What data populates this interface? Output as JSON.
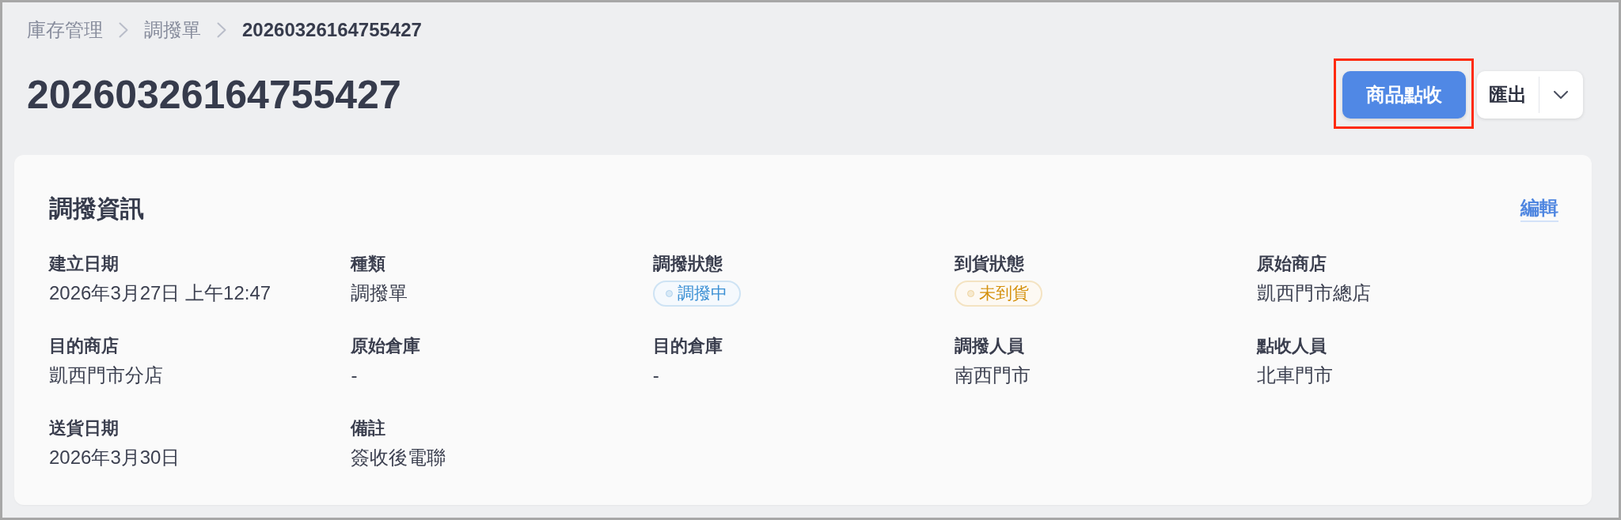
{
  "breadcrumb": [
    {
      "label": "庫存管理",
      "current": false
    },
    {
      "label": "調撥單",
      "current": false
    },
    {
      "label": "20260326164755427",
      "current": true
    }
  ],
  "page_title": "20260326164755427",
  "actions": {
    "primary": {
      "label": "商品點收",
      "highlighted": true
    },
    "export": {
      "label": "匯出"
    }
  },
  "card": {
    "title": "調撥資訊",
    "edit_link": "編輯",
    "fields": [
      {
        "label": "建立日期",
        "kind": "text",
        "value": "2026年3月27日 上午12:47"
      },
      {
        "label": "種類",
        "kind": "text",
        "value": "調撥單"
      },
      {
        "label": "調撥狀態",
        "kind": "badge",
        "value": "調撥中",
        "color": "#3a8fd4"
      },
      {
        "label": "到貨狀態",
        "kind": "badge",
        "value": "未到貨",
        "color": "#d4900c"
      },
      {
        "label": "原始商店",
        "kind": "text",
        "value": "凱西門市總店"
      },
      {
        "label": "目的商店",
        "kind": "text",
        "value": "凱西門市分店"
      },
      {
        "label": "原始倉庫",
        "kind": "text",
        "value": "-"
      },
      {
        "label": "目的倉庫",
        "kind": "text",
        "value": "-"
      },
      {
        "label": "調撥人員",
        "kind": "text",
        "value": "南西門市"
      },
      {
        "label": "點收人員",
        "kind": "text",
        "value": "北車門市"
      },
      {
        "label": "送貨日期",
        "kind": "text",
        "value": "2026年3月30日"
      },
      {
        "label": "備註",
        "kind": "text",
        "value": "簽收後電聯"
      }
    ]
  }
}
